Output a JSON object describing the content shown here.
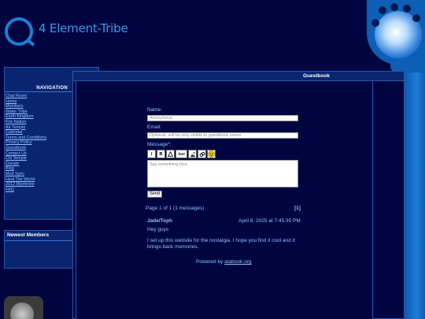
{
  "header": {
    "site_title": "4 Element-Tribe"
  },
  "navigation": {
    "heading": "NAVIGATION",
    "items": [
      "Chat Room",
      "Home",
      "Members",
      "Water Tribe",
      "Earth Kingdom",
      "Fire Nation",
      "Air Temple",
      "Calendar",
      "Terms and Conditions",
      "Privacy Policy",
      "Guestbook",
      "Contact Us",
      "Chi Temple",
      "Donate",
      "Blog",
      "Mod Sync",
      "Heal The World",
      "2012 Mysteries",
      "FAQ"
    ]
  },
  "newest_members": {
    "title": "Newest Members"
  },
  "guestbook": {
    "title": "Guestbook",
    "form": {
      "name_label": "Name:",
      "name_value": "Anonymous",
      "email_label": "Email:",
      "email_placeholder": "Optional, will be only visible to guestbook owner",
      "message_label": "Message*:",
      "message_placeholder": "Say something nice",
      "toolbar": [
        "I",
        "B",
        "A",
        "font",
        "img",
        "link",
        "smile"
      ],
      "send_label": "Send"
    },
    "pagination": {
      "info": "Page 1 of 1 (1 messages)",
      "page_link": "[1]"
    },
    "entries": [
      {
        "author": "Jade/Toph",
        "timestamp": "April 8, 2025 at 7:45:35 PM",
        "greeting": "Hey guys",
        "body": "I set up this website for the nostalgia. I hope you find it cool and it brings back memories."
      }
    ],
    "powered_prefix": "Powered by ",
    "powered_link": "atabook.org"
  },
  "colors": {
    "background": "#000540",
    "accent": "#1b7fd6",
    "link": "#8fc0ff",
    "panel": "#0a2570"
  }
}
